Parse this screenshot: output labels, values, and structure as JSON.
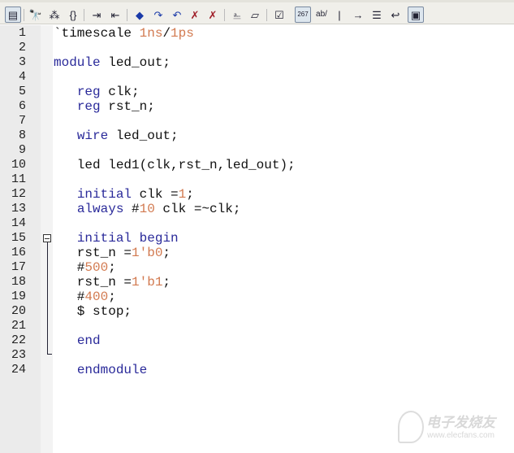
{
  "toolbar": {
    "items": [
      {
        "icon": "options-icon",
        "glyph": "▤",
        "pressed": true
      },
      {
        "icon": "find-icon",
        "glyph": "🔭"
      },
      {
        "icon": "replace-icon",
        "glyph": "⁂"
      },
      {
        "icon": "match-brace-icon",
        "glyph": "{}"
      },
      {
        "icon": "indent-icon",
        "glyph": "⇥"
      },
      {
        "icon": "outdent-icon",
        "glyph": "⇤"
      },
      {
        "icon": "bookmark-toggle-icon",
        "glyph": "◆"
      },
      {
        "icon": "bookmark-next-icon",
        "glyph": "↷"
      },
      {
        "icon": "bookmark-prev-icon",
        "glyph": "↶"
      },
      {
        "icon": "bookmark-clear-icon",
        "glyph": "✗"
      },
      {
        "icon": "bookmark-clear-all-icon",
        "glyph": "✗"
      },
      {
        "icon": "paperclip-icon",
        "glyph": "⎁"
      },
      {
        "icon": "scroll-icon",
        "glyph": "▱"
      },
      {
        "icon": "check-document-icon",
        "glyph": "☑"
      },
      {
        "icon": "line-numbers-icon",
        "glyph": "267",
        "pressed": true
      },
      {
        "icon": "word-wrap-icon",
        "glyph": "ab/"
      },
      {
        "icon": "cursor-icon",
        "glyph": "|"
      },
      {
        "icon": "show-whitespace-icon",
        "glyph": "→"
      },
      {
        "icon": "indent-guides-icon",
        "glyph": "☰"
      },
      {
        "icon": "wrap-lines-icon",
        "glyph": "↩"
      },
      {
        "icon": "view-icon",
        "glyph": "▣",
        "pressed": true
      }
    ]
  },
  "editor": {
    "lines": [
      [
        [
          "`timescale ",
          ""
        ],
        [
          "1ns",
          "num"
        ],
        [
          "/",
          ""
        ],
        [
          "1ps",
          "num"
        ]
      ],
      [],
      [
        [
          "module",
          "kw"
        ],
        [
          " led_out;",
          ""
        ]
      ],
      [],
      [
        [
          "   ",
          ""
        ],
        [
          "reg",
          "kw"
        ],
        [
          " clk;",
          ""
        ]
      ],
      [
        [
          "   ",
          ""
        ],
        [
          "reg",
          "kw"
        ],
        [
          " rst_n;",
          ""
        ]
      ],
      [],
      [
        [
          "   ",
          ""
        ],
        [
          "wire",
          "kw"
        ],
        [
          " led_out;",
          ""
        ]
      ],
      [],
      [
        [
          "   led led1(clk,rst_n,led_out);",
          ""
        ]
      ],
      [],
      [
        [
          "   ",
          ""
        ],
        [
          "initial",
          "kw"
        ],
        [
          " clk =",
          ""
        ],
        [
          "1",
          "num"
        ],
        [
          ";",
          ""
        ]
      ],
      [
        [
          "   ",
          ""
        ],
        [
          "always",
          "kw"
        ],
        [
          " #",
          ""
        ],
        [
          "10",
          "num"
        ],
        [
          " clk =~clk;",
          ""
        ]
      ],
      [],
      [
        [
          "   ",
          ""
        ],
        [
          "initial",
          "kw"
        ],
        [
          " ",
          ""
        ],
        [
          "begin",
          "kw"
        ]
      ],
      [
        [
          "   rst_n =",
          ""
        ],
        [
          "1'b0",
          "num"
        ],
        [
          ";",
          ""
        ]
      ],
      [
        [
          "   #",
          ""
        ],
        [
          "500",
          "num"
        ],
        [
          ";",
          ""
        ]
      ],
      [
        [
          "   rst_n =",
          ""
        ],
        [
          "1'b1",
          "num"
        ],
        [
          ";",
          ""
        ]
      ],
      [
        [
          "   #",
          ""
        ],
        [
          "400",
          "num"
        ],
        [
          ";",
          ""
        ]
      ],
      [
        [
          "   $ stop;",
          ""
        ]
      ],
      [],
      [
        [
          "   ",
          ""
        ],
        [
          "end",
          "kw"
        ]
      ],
      [],
      [
        [
          "   ",
          ""
        ],
        [
          "endmodule",
          "kw"
        ]
      ]
    ]
  },
  "watermark": {
    "brand": "电子发烧友",
    "url": "www.elecfans.com"
  }
}
